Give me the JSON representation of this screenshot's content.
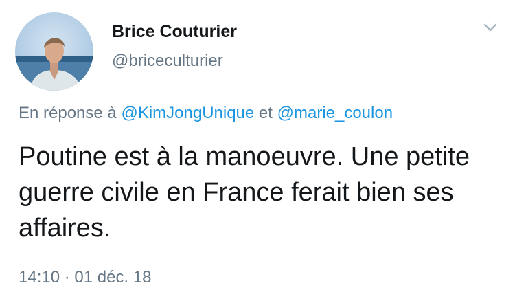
{
  "author": {
    "name": "Brice Couturier",
    "handle": "@briceculturier",
    "avatar_icon": "profile-photo"
  },
  "menu": {
    "icon": "chevron-down-icon"
  },
  "reply": {
    "prefix": "En réponse à",
    "mention1": "@KimJongUnique",
    "joiner": "et",
    "mention2": "@marie_coulon"
  },
  "tweet": {
    "text": "Poutine est à la manoeuvre. Une petite guerre civile en France ferait bien ses affaires.",
    "timestamp": "14:10 · 01 déc. 18"
  },
  "colors": {
    "mention": "#1b95e0",
    "secondary_text": "#657786",
    "primary_text": "#14171a"
  }
}
